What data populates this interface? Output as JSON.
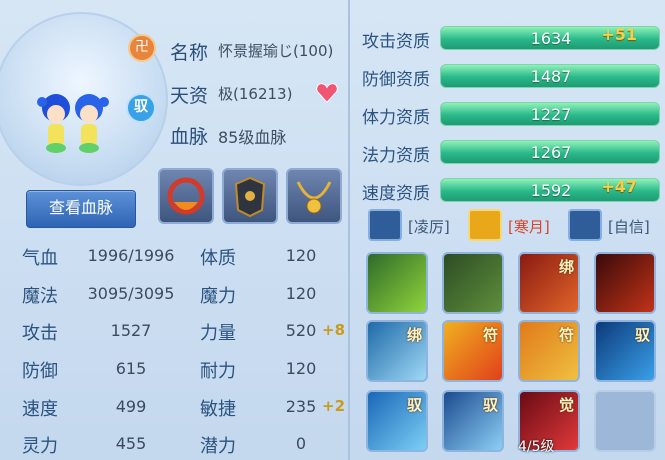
{
  "pet": {
    "name_label": "名称",
    "name_value": "怀景握瑜じ(100)",
    "talent_label": "天资",
    "talent_value": "极(16213)",
    "bloodline_label": "血脉",
    "bloodline_value": "85级血脉",
    "view_bloodline_button": "查看血脉",
    "badge_rank": "卍",
    "badge_yu": "驭"
  },
  "stats": [
    {
      "label": "气血",
      "value": "1996/1996",
      "label2": "体质",
      "value2": "120",
      "bonus2": ""
    },
    {
      "label": "魔法",
      "value": "3095/3095",
      "label2": "魔力",
      "value2": "120",
      "bonus2": ""
    },
    {
      "label": "攻击",
      "value": "1527",
      "label2": "力量",
      "value2": "520",
      "bonus2": "+8"
    },
    {
      "label": "防御",
      "value": "615",
      "label2": "耐力",
      "value2": "120",
      "bonus2": ""
    },
    {
      "label": "速度",
      "value": "499",
      "label2": "敏捷",
      "value2": "235",
      "bonus2": "+2"
    },
    {
      "label": "灵力",
      "value": "455",
      "label2": "潜力",
      "value2": "0",
      "bonus2": ""
    }
  ],
  "qualities": [
    {
      "label": "攻击资质",
      "value": "1634",
      "bonus": "+51"
    },
    {
      "label": "防御资质",
      "value": "1487",
      "bonus": ""
    },
    {
      "label": "体力资质",
      "value": "1227",
      "bonus": ""
    },
    {
      "label": "法力资质",
      "value": "1267",
      "bonus": ""
    },
    {
      "label": "速度资质",
      "value": "1592",
      "bonus": "+47"
    }
  ],
  "aspects": [
    {
      "label": "[凌厉]",
      "color": "#3c5675"
    },
    {
      "label": "[寒月]",
      "color": "#d9452a"
    },
    {
      "label": "[自信]",
      "color": "#3c5675"
    }
  ],
  "skills": [
    {
      "tag": "",
      "icon": "ghost-skill-icon"
    },
    {
      "tag": "",
      "icon": "beast-skill-icon"
    },
    {
      "tag": "绑",
      "icon": "strike-skill-icon"
    },
    {
      "tag": "",
      "icon": "demon-skill-icon"
    },
    {
      "tag": "绑",
      "icon": "sword-skill-icon"
    },
    {
      "tag": "符",
      "icon": "fire-skill-icon"
    },
    {
      "tag": "符",
      "icon": "blade-skill-icon"
    },
    {
      "tag": "驭",
      "icon": "tiger-skill-icon"
    },
    {
      "tag": "驭",
      "icon": "shield-skill-icon"
    },
    {
      "tag": "驭",
      "icon": "ice-skill-icon"
    },
    {
      "tag": "觉",
      "icon": "awaken-skill-icon"
    },
    {
      "tag": "",
      "icon": "empty-slot"
    }
  ],
  "skill_level_text": "4/5级"
}
